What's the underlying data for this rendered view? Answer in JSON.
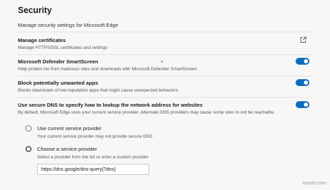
{
  "header": {
    "title": "Security",
    "subtitle": "Manage security settings for Microsoft Edge"
  },
  "settings": [
    {
      "title": "Manage certificates",
      "description": "Manage HTTPS/SSL certificates and settings",
      "control": "external-link-icon"
    },
    {
      "title": "Microsoft Defender SmartScreen",
      "description": "Help protect me from malicious sites and downloads with Microsoft Defender SmartScreen.",
      "enabled": true
    },
    {
      "title": "Block potentially unwanted apps",
      "description": "Blocks downloads of low-reputation apps that might cause unexpected behaviors.",
      "enabled": true
    },
    {
      "title": "Use secure DNS to specify how to lookup the network address for websites",
      "description": "By default, Microsoft Edge uses your current service provider. Alternate DNS providers may cause some sites to not be reachable.",
      "enabled": true
    }
  ],
  "dns": {
    "options": [
      {
        "title": "Use current service provider",
        "description": "Your current service provider may not provide secure DNS",
        "selected": false
      },
      {
        "title": "Choose a service provider",
        "description": "Select a provider from the list or enter a custom provider",
        "selected": true
      }
    ],
    "provider_value": "https://dns.google/dns-query{?dns}"
  },
  "watermark": "wsxdn.com",
  "colors": {
    "accent": "#0f6cbd",
    "background": "#f7f7f7"
  }
}
